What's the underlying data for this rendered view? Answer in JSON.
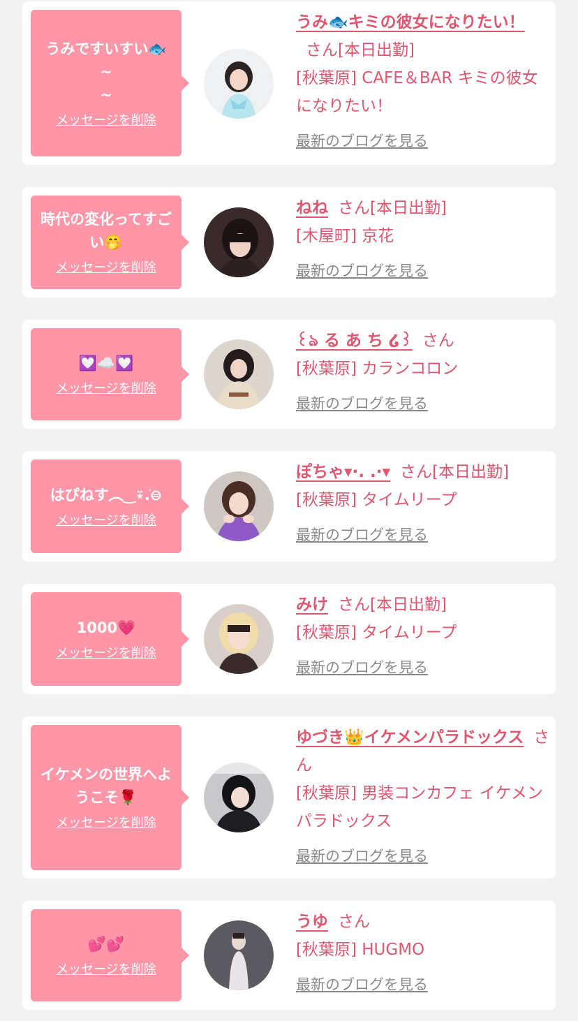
{
  "messages": [
    {
      "bubble_text": "うみですいすい🐟\n~\n~",
      "delete_label": "メッセージを削除",
      "name": "うみ🐟キミの彼女になりたい！",
      "suffix": "さん[本日出勤]",
      "shop": "[秋葉原] CAFE＆BAR キミの彼女になりたい！",
      "blog_label": "最新のブログを見る"
    },
    {
      "bubble_text": "時代の変化ってすごい🤭",
      "delete_label": "メッセージを削除",
      "name": "ねね",
      "suffix": "さん[本日出勤]",
      "shop": "[木屋町] 京花",
      "blog_label": "最新のブログを見る"
    },
    {
      "bubble_text": "💟☁️💟",
      "delete_label": "メッセージを削除",
      "name": "꒰ঌ る あ ち ໒꒱",
      "suffix": "さん",
      "shop": "[秋葉原] カランコロン",
      "blog_label": "最新のブログを見る"
    },
    {
      "bubble_text": "はぴねす︵‿⍣.ֹ⊜",
      "delete_label": "メッセージを削除",
      "name": "ぽちゃ▾·. .·▾",
      "suffix": "さん[本日出勤]",
      "shop": "[秋葉原] タイムリープ",
      "blog_label": "最新のブログを見る"
    },
    {
      "bubble_text": "1000💗",
      "delete_label": "メッセージを削除",
      "name": "みけ",
      "suffix": "さん[本日出勤]",
      "shop": "[秋葉原] タイムリープ",
      "blog_label": "最新のブログを見る"
    },
    {
      "bubble_text": "イケメンの世界へようこそ🌹",
      "delete_label": "メッセージを削除",
      "name": "ゆづき👑イケメンパラドックス",
      "suffix": "さん",
      "shop": "[秋葉原] 男装コンカフェ イケメンパラドックス",
      "blog_label": "最新のブログを見る"
    },
    {
      "bubble_text": "💕💕",
      "delete_label": "メッセージを削除",
      "name": "うゆ",
      "suffix": "さん",
      "shop": "[秋葉原] HUGMO",
      "blog_label": "最新のブログを見る"
    }
  ]
}
